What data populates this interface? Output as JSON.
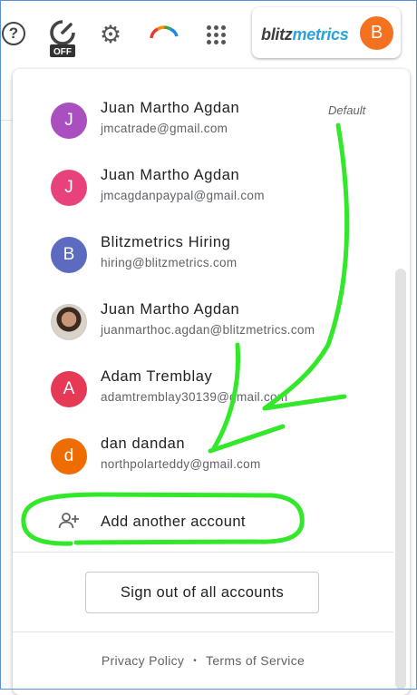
{
  "toolbar": {
    "timer_badge": "OFF",
    "brand_part1": "blitz",
    "brand_part2": "metrics",
    "avatar_initial": "B"
  },
  "accounts": [
    {
      "initial": "J",
      "name": "Juan Martho Agdan",
      "email": "jmcatrade@gmail.com",
      "color": "#a94fc0",
      "tag": "Default"
    },
    {
      "initial": "J",
      "name": "Juan Martho Agdan",
      "email": "jmcagdanpaypal@gmail.com",
      "color": "#e8427c"
    },
    {
      "initial": "B",
      "name": "Blitzmetrics Hiring",
      "email": "hiring@blitzmetrics.com",
      "color": "#5c6bc0"
    },
    {
      "initial": "",
      "name": "Juan Martho Agdan",
      "email": "juanmarthoc.agdan@blitzmetrics.com",
      "photo": true
    },
    {
      "initial": "A",
      "name": "Adam Tremblay",
      "email": "adamtremblay30139@gmail.com",
      "color": "#e53955"
    },
    {
      "initial": "d",
      "name": "dan dandan",
      "email": "northpolarteddy@gmail.com",
      "color": "#ef6c00"
    }
  ],
  "add_account_label": "Add another account",
  "signout_label": "Sign out of all accounts",
  "footer": {
    "privacy": "Privacy Policy",
    "separator": "•",
    "terms": "Terms of Service"
  },
  "colors": {
    "annotation": "#33e82a",
    "brand_blue": "#2aa3d9",
    "avatar_orange": "#f4711f"
  }
}
